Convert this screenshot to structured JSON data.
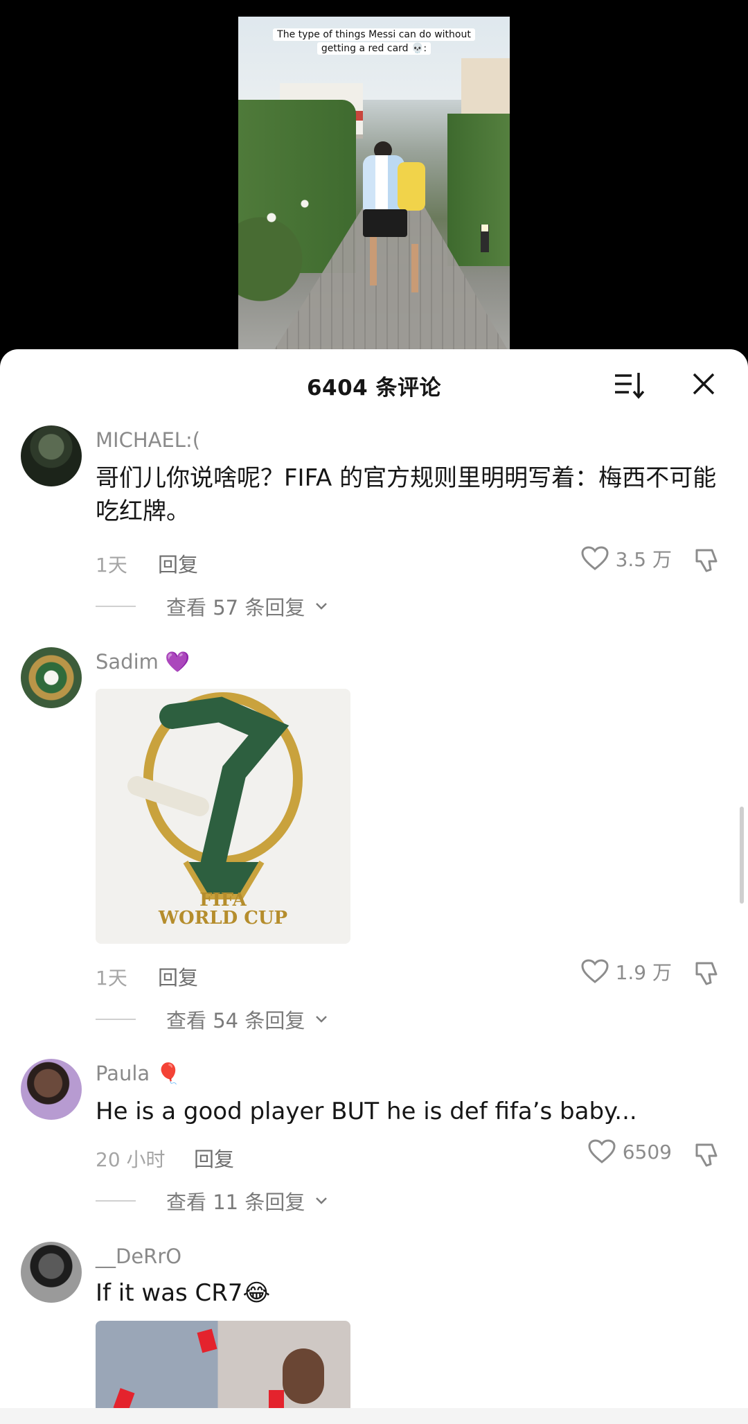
{
  "video": {
    "caption_line1": "The type of things Messi can do without",
    "caption_line2": "getting a red card 💀:"
  },
  "panel": {
    "title": "6404 条评论"
  },
  "comments": [
    {
      "username": "MICHAEL:(",
      "text": "哥们儿你说啥呢？FIFA 的官方规则里明明写着：梅西不可能吃红牌。",
      "time": "1天",
      "reply_label": "回复",
      "likes": "3.5 万",
      "view_replies": "查看 57 条回复"
    },
    {
      "username": "Sadim 💜",
      "image": {
        "line1": "FIFA",
        "line2": "WORLD CUP"
      },
      "time": "1天",
      "reply_label": "回复",
      "likes": "1.9 万",
      "view_replies": "查看 54 条回复"
    },
    {
      "username": "Paula 🎈",
      "text": "He is a good player BUT he is def fifa’s baby...",
      "time": "20 小时",
      "reply_label": "回复",
      "likes": "6509",
      "view_replies": "查看 11 条回复"
    },
    {
      "username": "__DeRrO",
      "text": "If it was CR7😂"
    }
  ],
  "colors": {
    "like_gray": "#8c8c8c",
    "text": "#161616",
    "accent_red": "#e4232d"
  }
}
